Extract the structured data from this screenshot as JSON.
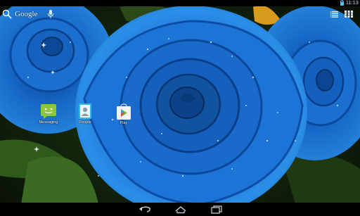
{
  "status_bar": {
    "time": "11:13",
    "battery_icon": "battery-icon",
    "accent_color": "#4fc3f7"
  },
  "search": {
    "label": "Google",
    "search_icon": "search-icon",
    "mic_icon": "microphone-icon"
  },
  "top_right": {
    "menu_icon": "menu-icon",
    "all_apps_icon": "all-apps-grid-icon"
  },
  "shortcuts": [
    {
      "label": "Messaging",
      "icon": "messaging-icon",
      "color": "#8dc63f"
    },
    {
      "label": "People",
      "icon": "people-icon",
      "color": "#33b5e5"
    },
    {
      "label": "Play",
      "icon": "play-store-icon",
      "color": "#f2f2f2"
    }
  ],
  "nav_bar": {
    "back_icon": "back-icon",
    "home_icon": "home-icon",
    "recents_icon": "recents-icon"
  },
  "wallpaper": {
    "subject": "blue-roses",
    "rose_color": "#1e7fd8"
  }
}
